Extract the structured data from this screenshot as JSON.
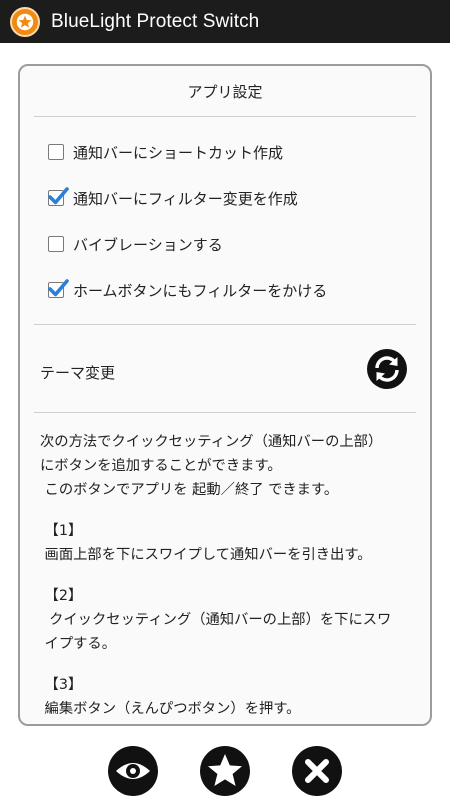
{
  "app": {
    "title": "BlueLight Protect Switch",
    "icon": "app-logo-icon",
    "accent": "#f08a12"
  },
  "panel": {
    "header": "アプリ設定",
    "settings": [
      {
        "label": "通知バーにショートカット作成",
        "checked": false
      },
      {
        "label": "通知バーにフィルター変更を作成",
        "checked": true
      },
      {
        "label": "バイブレーションする",
        "checked": false
      },
      {
        "label": "ホームボタンにもフィルターをかける",
        "checked": true
      }
    ],
    "theme": {
      "label": "テーマ変更",
      "icon": "refresh-icon"
    },
    "help": {
      "intro1": "次の方法でクイックセッティング（通知バーの上部）",
      "intro2": "にボタンを追加することができます。",
      "intro3": " このボタンでアプリを 起動／終了 できます。",
      "step1_title": " 【1】",
      "step1_text": " 画面上部を下にスワイプして通知バーを引き出す。",
      "step2_title": " 【2】",
      "step2_text1": "  クイックセッティング（通知バーの上部）を下にスワ",
      "step2_text2": " イプする。",
      "step3_title": " 【3】",
      "step3_text": " 編集ボタン（えんぴつボタン）を押す。"
    }
  },
  "bottom_bar": [
    {
      "icon": "eye-icon"
    },
    {
      "icon": "star-icon"
    },
    {
      "icon": "close-icon"
    }
  ],
  "colors": {
    "check_mark": "#2a7fd6",
    "titlebar": "#1c1c1c",
    "icon_fill": "#111111"
  }
}
